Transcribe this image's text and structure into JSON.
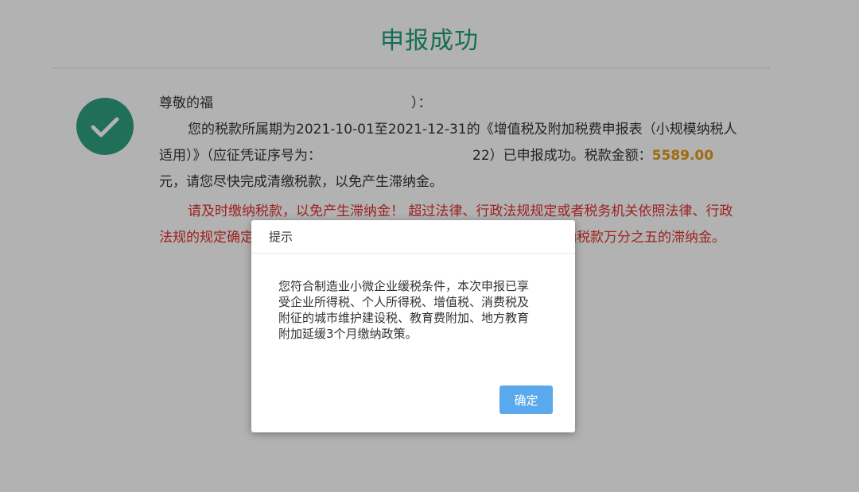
{
  "page": {
    "title": "申报成功",
    "greeting": "尊敬的福",
    "greeting_suffix": "）：",
    "line2": "您的税款所属期为2021-10-01至2021-12-31的《增值税及附加税费申报表（小规模纳税人",
    "line3_prefix": "适用）》（应征凭证序号为：",
    "line3_mid": "22）已申报成功。税款金额：",
    "amount": "5589.00",
    "line4": "元，请您尽快完成清缴税款，以免产生滞纳金。",
    "warning_line1": "请及时缴纳税款，以免产生滞纳金！ 超过法律、行政法规规定或者税务机关依照法律、行政",
    "warning_line2_start": "法规的规定确定",
    "warning_line2_end": "纳税款万分之五的滞纳金。"
  },
  "dialog": {
    "title": "提示",
    "body_lines": [
      "您符合制造业小微企业缓税条件，本次申报已享",
      "受企业所得税、个人所得税、增值税、消费税及",
      "附征的城市维护建设税、教育费附加、地方教育",
      "附加延缓3个月缴纳政策。"
    ],
    "ok_label": "确定"
  },
  "colors": {
    "title": "#1e9e77",
    "check_circle": "#2e9f7f",
    "amount": "#e29a18",
    "warning": "#e0312f",
    "ok_button": "#5aa9ec"
  },
  "icons": {
    "success": "check-circle-icon"
  }
}
